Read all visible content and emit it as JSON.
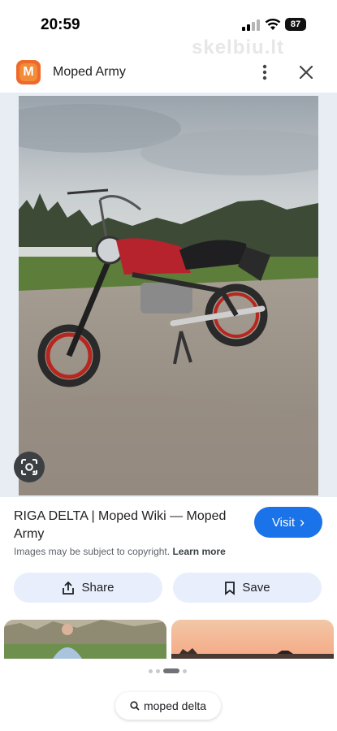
{
  "status_bar": {
    "time": "20:59",
    "battery": "87",
    "watermark": "skelbiu.lt"
  },
  "header": {
    "logo_letter": "M",
    "site_name": "Moped Army",
    "accent_color": "#ef6a2a"
  },
  "result": {
    "title": "RIGA DELTA | Moped Wiki — Moped Army",
    "visit_label": "Visit",
    "visit_arrow": "›",
    "copyright_text": "Images may be subject to copyright.",
    "learn_more_label": "Learn more"
  },
  "actions": {
    "share_label": "Share",
    "save_label": "Save"
  },
  "search": {
    "query": "moped delta"
  },
  "colors": {
    "visit_button": "#1a73e8",
    "action_button_bg": "#e8eefb"
  },
  "icons": [
    "signal-icon",
    "wifi-icon",
    "more-vert-icon",
    "close-icon",
    "lens-icon",
    "share-icon",
    "bookmark-icon",
    "search-icon"
  ]
}
